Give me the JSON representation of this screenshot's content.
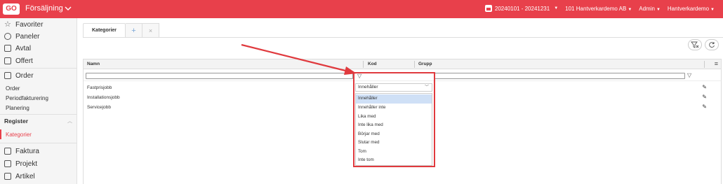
{
  "topbar": {
    "logo": "GO",
    "app_title": "Försäljning",
    "period": "20240101 - 20241231",
    "company": "101 Hantverkardemo AB",
    "role": "Admin",
    "user": "Hantverkardemo",
    "color": "#e8404b"
  },
  "sidebar": {
    "items": [
      {
        "label": "Favoriter",
        "icon": "star-icon"
      },
      {
        "label": "Paneler",
        "icon": "gauge-icon"
      },
      {
        "label": "Avtal",
        "icon": "contract-icon"
      },
      {
        "label": "Offert",
        "icon": "document-icon"
      },
      {
        "label": "Order",
        "icon": "order-icon"
      }
    ],
    "order_sub": [
      "Order",
      "Periodfakturering",
      "Planering"
    ],
    "register_label": "Register",
    "register_sub": [
      "Kategorier"
    ],
    "bottom_items": [
      {
        "label": "Faktura",
        "icon": "invoice-icon"
      },
      {
        "label": "Projekt",
        "icon": "project-icon"
      },
      {
        "label": "Artikel",
        "icon": "article-icon"
      }
    ]
  },
  "tabs": {
    "active": "Kategorier",
    "add": "+",
    "close": "×"
  },
  "grid": {
    "columns": [
      "Namn",
      "Kod",
      "Grupp"
    ],
    "rows": [
      {
        "namn": "Fastprisjobb"
      },
      {
        "namn": "Installationsjobb"
      },
      {
        "namn": "Servicejobb"
      }
    ]
  },
  "filter_dropdown": {
    "selected": "Innehåller",
    "options": [
      "Innehåller",
      "Innehåller inte",
      "Lika med",
      "Inte lika med",
      "Börjar med",
      "Slutar med",
      "Tom",
      "Inte tom"
    ]
  }
}
